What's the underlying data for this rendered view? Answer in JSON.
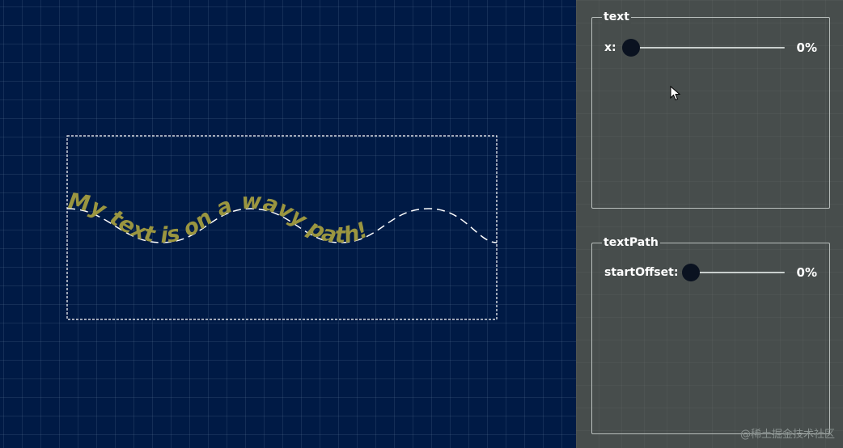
{
  "stage": {
    "text_content": "My text is on a wavy path!",
    "text_color": "#9a9540",
    "path_color": "#ffffff",
    "box_color": "#ffffff"
  },
  "controls": {
    "text_group": {
      "title": "text",
      "x": {
        "label": "x:",
        "value_text": "0%",
        "value": 0
      }
    },
    "textpath_group": {
      "title": "textPath",
      "start_offset": {
        "label": "startOffset:",
        "value_text": "0%",
        "value": 0
      }
    }
  },
  "watermark": "@稀土掘金技术社区"
}
